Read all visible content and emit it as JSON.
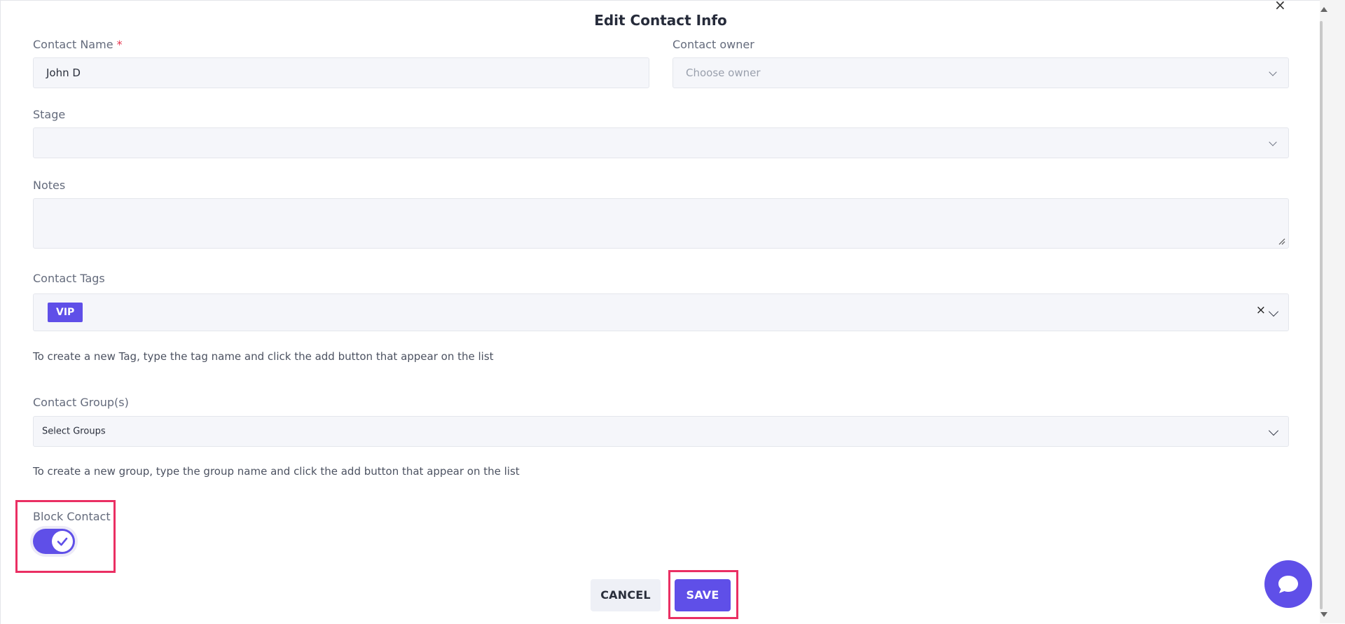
{
  "modal": {
    "title": "Edit Contact Info",
    "close_glyph": "×"
  },
  "contact_name": {
    "label": "Contact Name",
    "required_mark": "*",
    "value": "John D"
  },
  "contact_owner": {
    "label": "Contact owner",
    "placeholder": "Choose owner"
  },
  "stage": {
    "label": "Stage",
    "value": ""
  },
  "notes": {
    "label": "Notes",
    "value": ""
  },
  "contact_tags": {
    "label": "Contact Tags",
    "tags": [
      "VIP"
    ],
    "clear_glyph": "×",
    "hint": "To create a new Tag, type the tag name and click the add button that appear on the list"
  },
  "contact_groups": {
    "label": "Contact Group(s)",
    "placeholder": "Select Groups",
    "hint": "To create a new group, type the group name and click the add button that appear on the list"
  },
  "block_contact": {
    "label": "Block Contact",
    "enabled": true
  },
  "actions": {
    "cancel_label": "CANCEL",
    "save_label": "SAVE"
  },
  "colors": {
    "accent": "#5f4fe8",
    "highlight": "#ea2f63",
    "required": "#e8344d"
  },
  "icons": {
    "close": "close-icon",
    "dropdown": "chevron-down-icon",
    "check": "check-icon",
    "chat": "chat-bubble-icon"
  }
}
